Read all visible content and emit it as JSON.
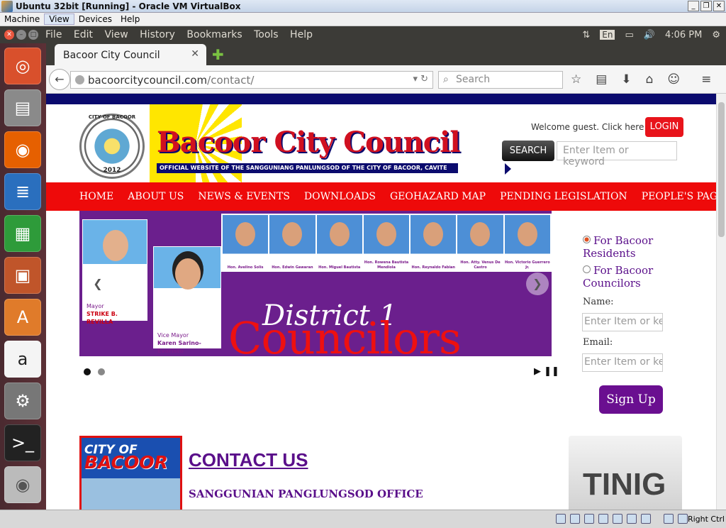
{
  "vbox": {
    "title": "Ubuntu 32bit [Running] - Oracle VM VirtualBox",
    "menu": [
      "Machine",
      "View",
      "Devices",
      "Help"
    ],
    "statusbar_right": "Right Ctrl"
  },
  "ubuntu": {
    "menu": [
      "File",
      "Edit",
      "View",
      "History",
      "Bookmarks",
      "Tools",
      "Help"
    ],
    "lang": "En",
    "time": "4:06 PM",
    "launcher": [
      {
        "name": "ubuntu-dash-icon",
        "color": "#d9502c"
      },
      {
        "name": "files-icon",
        "color": "#8a8a8a"
      },
      {
        "name": "firefox-icon",
        "color": "#e66000"
      },
      {
        "name": "writer-icon",
        "color": "#2a6fbe"
      },
      {
        "name": "calc-icon",
        "color": "#2e9b3a"
      },
      {
        "name": "impress-icon",
        "color": "#c0552a"
      },
      {
        "name": "software-center-icon",
        "color": "#e07b2a"
      },
      {
        "name": "amazon-icon",
        "color": "#444444"
      },
      {
        "name": "system-settings-icon",
        "color": "#777777"
      },
      {
        "name": "terminal-icon",
        "color": "#333333"
      },
      {
        "name": "dvd-icon",
        "color": "#bbbbbb"
      }
    ]
  },
  "browser": {
    "tab_title": "Bacoor City Council",
    "url_domain": "bacoorcitycouncil.com",
    "url_path": "/contact/",
    "search_placeholder": "Search"
  },
  "site": {
    "logo_text": "CITY OF BACOOR",
    "logo_year": "2012",
    "title": "Bacoor City Council",
    "subtitle": "OFFICIAL WEBSITE OF THE SANGGUNIANG PANLUNGSOD OF THE CITY OF BACOOR, CAVITE",
    "welcome": "Welcome guest. Click here to",
    "login": "LOGIN",
    "search_button": "SEARCH",
    "search_placeholder": "Enter Item or keyword",
    "nav": [
      "HOME",
      "ABOUT US",
      "NEWS & EVENTS",
      "DOWNLOADS",
      "GEOHAZARD MAP",
      "PENDING LEGISLATION",
      "PEOPLE'S PAGE"
    ],
    "slider": {
      "mayor_role": "Mayor",
      "mayor_name": "STRIKE B. REVILLA",
      "vice_role": "Vice Mayor",
      "vice_name": "Karen Sarino-Evaristo",
      "councilors": [
        "Hon. Avelino Solis",
        "Hon. Edwin Gawaran",
        "Hon. Miguel Bautista",
        "Hon. Rowena Bautista Mendiola",
        "Hon. Reynaldo Fabian",
        "Hon. Atty. Venus De Castro",
        "Hon. Victorio Guerrero Jr."
      ],
      "district": "District 1",
      "heading": "Councilors"
    },
    "subscribe": {
      "option1": "For Bacoor Residents",
      "option2": "For Bacoor Councilors",
      "name_label": "Name:",
      "email_label": "Email:",
      "placeholder": "Enter Item or keyword",
      "button": "Sign Up"
    },
    "city_label_small": "CITY OF",
    "city_label_big": "BACOOR",
    "contact_title": "CONTACT US",
    "office": "SANGGUNIAN PANGLUNGSOD OFFICE",
    "tinig": "TINIG"
  }
}
